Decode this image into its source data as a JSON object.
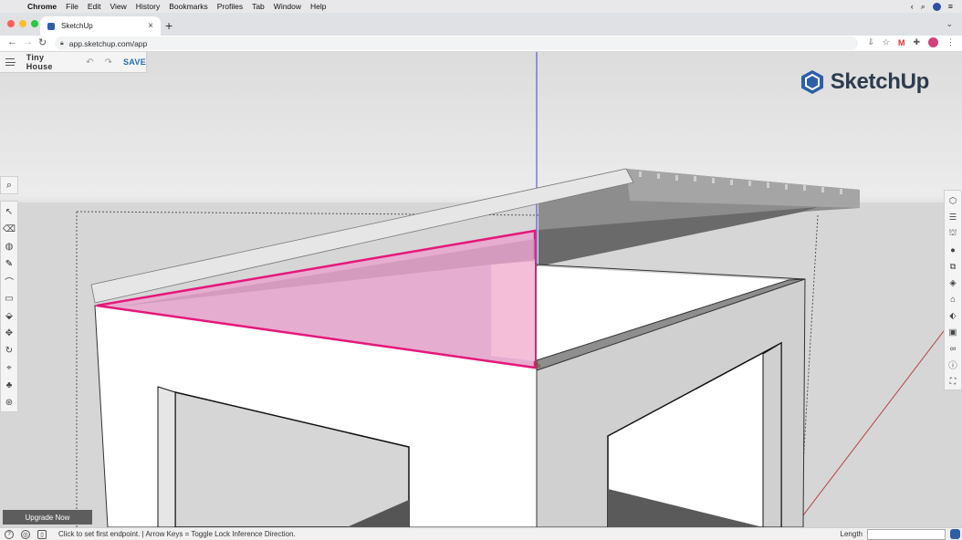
{
  "menubar": {
    "apple_glyph": "",
    "items": [
      "Chrome",
      "File",
      "Edit",
      "View",
      "History",
      "Bookmarks",
      "Profiles",
      "Tab",
      "Window",
      "Help"
    ]
  },
  "browser": {
    "tab_title": "SketchUp",
    "tab_close": "×",
    "new_tab": "+",
    "url": "app.sketchup.com/app",
    "back": "←",
    "forward": "→",
    "reload": "↻"
  },
  "app": {
    "model_title": "Tiny House",
    "undo_icon": "↶",
    "redo_icon": "↷",
    "save_label": "SAVE",
    "logo_text": "SketchUp",
    "upgrade_label": "Upgrade Now",
    "search_icon": "⌕"
  },
  "left_toolbar": {
    "tools": [
      {
        "name": "select-tool-icon",
        "glyph": "↖"
      },
      {
        "name": "eraser-tool-icon",
        "glyph": "⌫"
      },
      {
        "name": "paint-bucket-tool-icon",
        "glyph": "◍"
      },
      {
        "name": "pencil-tool-icon",
        "glyph": "✎"
      },
      {
        "name": "arc-tool-icon",
        "glyph": "⌒"
      },
      {
        "name": "rectangle-tool-icon",
        "glyph": "▭"
      },
      {
        "name": "push-pull-tool-icon",
        "glyph": "⬙"
      },
      {
        "name": "move-tool-icon",
        "glyph": "✥"
      },
      {
        "name": "rotate-tool-icon",
        "glyph": "↻"
      },
      {
        "name": "tape-measure-tool-icon",
        "glyph": "⌖"
      },
      {
        "name": "walk-tool-icon",
        "glyph": "♣"
      },
      {
        "name": "orbit-tool-icon",
        "glyph": "⊛"
      }
    ]
  },
  "right_toolbar": {
    "tools": [
      {
        "name": "entity-info-icon",
        "glyph": "⬡"
      },
      {
        "name": "outliner-icon",
        "glyph": "☰"
      },
      {
        "name": "scenes-icon",
        "glyph": "⛫"
      },
      {
        "name": "materials-icon",
        "glyph": "●"
      },
      {
        "name": "components-icon",
        "glyph": "⧉"
      },
      {
        "name": "styles-icon",
        "glyph": "◈"
      },
      {
        "name": "3d-warehouse-icon",
        "glyph": "⌂"
      },
      {
        "name": "tags-icon",
        "glyph": "⬖"
      },
      {
        "name": "extensions-icon",
        "glyph": "▣"
      },
      {
        "name": "display-icon",
        "glyph": "∞"
      },
      {
        "name": "info-icon",
        "glyph": "ⓘ"
      },
      {
        "name": "help-center-icon",
        "glyph": "⛶"
      }
    ]
  },
  "statusbar": {
    "help_icon": "?",
    "globe_icon": "◎",
    "instructor_icon": "▯",
    "text": "Click to set first endpoint. | Arrow Keys = Toggle Lock Inference Direction.",
    "length_label": "Length",
    "length_value": ""
  },
  "colors": {
    "selection_pink": "#e6177a",
    "pink_fill": "#e8a6cf",
    "axis_blue": "#3a46c6",
    "axis_red": "#b84040",
    "brand_blue": "#2d5ea8"
  }
}
